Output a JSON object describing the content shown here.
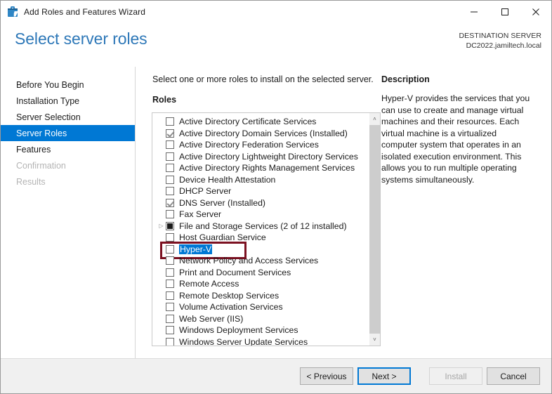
{
  "window": {
    "title": "Add Roles and Features Wizard",
    "icon": "toolbox-icon",
    "minimize_label": "—",
    "maximize_label": "□",
    "close_label": "✕"
  },
  "header": {
    "page_title": "Select server roles",
    "destination_label": "DESTINATION SERVER",
    "destination_server": "DC2022.jamiltech.local"
  },
  "nav": {
    "items": [
      {
        "label": "Before You Begin",
        "state": "normal"
      },
      {
        "label": "Installation Type",
        "state": "normal"
      },
      {
        "label": "Server Selection",
        "state": "normal"
      },
      {
        "label": "Server Roles",
        "state": "selected"
      },
      {
        "label": "Features",
        "state": "normal"
      },
      {
        "label": "Confirmation",
        "state": "disabled"
      },
      {
        "label": "Results",
        "state": "disabled"
      }
    ]
  },
  "content": {
    "instruction": "Select one or more roles to install on the selected server.",
    "roles_label": "Roles",
    "roles": [
      {
        "label": "Active Directory Certificate Services",
        "checkbox": "unchecked",
        "expander": false,
        "selected": false,
        "annotated": false
      },
      {
        "label": "Active Directory Domain Services (Installed)",
        "checkbox": "checked",
        "expander": false,
        "selected": false,
        "annotated": false
      },
      {
        "label": "Active Directory Federation Services",
        "checkbox": "unchecked",
        "expander": false,
        "selected": false,
        "annotated": false
      },
      {
        "label": "Active Directory Lightweight Directory Services",
        "checkbox": "unchecked",
        "expander": false,
        "selected": false,
        "annotated": false
      },
      {
        "label": "Active Directory Rights Management Services",
        "checkbox": "unchecked",
        "expander": false,
        "selected": false,
        "annotated": false
      },
      {
        "label": "Device Health Attestation",
        "checkbox": "unchecked",
        "expander": false,
        "selected": false,
        "annotated": false
      },
      {
        "label": "DHCP Server",
        "checkbox": "unchecked",
        "expander": false,
        "selected": false,
        "annotated": false
      },
      {
        "label": "DNS Server (Installed)",
        "checkbox": "checked",
        "expander": false,
        "selected": false,
        "annotated": false
      },
      {
        "label": "Fax Server",
        "checkbox": "unchecked",
        "expander": false,
        "selected": false,
        "annotated": false
      },
      {
        "label": "File and Storage Services (2 of 12 installed)",
        "checkbox": "partial",
        "expander": true,
        "selected": false,
        "annotated": false
      },
      {
        "label": "Host Guardian Service",
        "checkbox": "unchecked",
        "expander": false,
        "selected": false,
        "annotated": false
      },
      {
        "label": "Hyper-V",
        "checkbox": "unchecked",
        "expander": false,
        "selected": true,
        "annotated": true
      },
      {
        "label": "Network Policy and Access Services",
        "checkbox": "unchecked",
        "expander": false,
        "selected": false,
        "annotated": false
      },
      {
        "label": "Print and Document Services",
        "checkbox": "unchecked",
        "expander": false,
        "selected": false,
        "annotated": false
      },
      {
        "label": "Remote Access",
        "checkbox": "unchecked",
        "expander": false,
        "selected": false,
        "annotated": false
      },
      {
        "label": "Remote Desktop Services",
        "checkbox": "unchecked",
        "expander": false,
        "selected": false,
        "annotated": false
      },
      {
        "label": "Volume Activation Services",
        "checkbox": "unchecked",
        "expander": false,
        "selected": false,
        "annotated": false
      },
      {
        "label": "Web Server (IIS)",
        "checkbox": "unchecked",
        "expander": false,
        "selected": false,
        "annotated": false
      },
      {
        "label": "Windows Deployment Services",
        "checkbox": "unchecked",
        "expander": false,
        "selected": false,
        "annotated": false
      },
      {
        "label": "Windows Server Update Services",
        "checkbox": "unchecked",
        "expander": false,
        "selected": false,
        "annotated": false
      }
    ],
    "scrollbar": {
      "up_arrow": "˄",
      "down_arrow": "˅"
    },
    "description": {
      "title": "Description",
      "text": "Hyper-V provides the services that you can use to create and manage virtual machines and their resources. Each virtual machine is a virtualized computer system that operates in an isolated execution environment. This allows you to run multiple operating systems simultaneously."
    }
  },
  "footer": {
    "previous_label": "< Previous",
    "next_label": "Next >",
    "install_label": "Install",
    "cancel_label": "Cancel"
  },
  "colors": {
    "accent": "#0078d4",
    "title_blue": "#2e78b8",
    "annotation_red": "#7b1121",
    "footer_bg": "#f0f0f0"
  }
}
